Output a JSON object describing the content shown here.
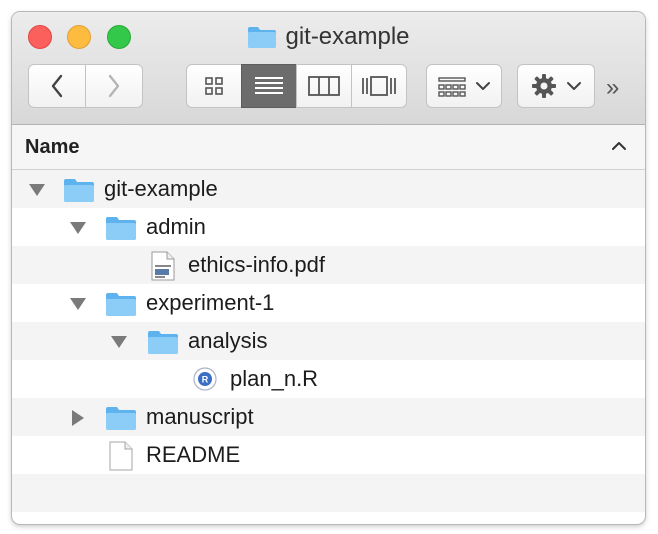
{
  "window": {
    "title": "git-example"
  },
  "toolbar": {
    "back_icon": "chevron-left-icon",
    "forward_icon": "chevron-right-icon",
    "views": [
      "icon-view",
      "list-view",
      "column-view",
      "cover-flow-view"
    ],
    "selected_view": "list-view",
    "arrange_icon": "arrange-grid-icon",
    "action_icon": "gear-icon",
    "overflow": "»"
  },
  "list_header": {
    "name_column": "Name",
    "sort_direction": "ascending"
  },
  "rows": [
    {
      "label": "git-example",
      "type": "folder",
      "expanded": true
    },
    {
      "label": "admin",
      "type": "folder",
      "expanded": true
    },
    {
      "label": "ethics-info.pdf",
      "type": "pdf-file"
    },
    {
      "label": "experiment-1",
      "type": "folder",
      "expanded": true
    },
    {
      "label": "analysis",
      "type": "folder",
      "expanded": true
    },
    {
      "label": "plan_n.R",
      "type": "r-script-file",
      "badge": "R"
    },
    {
      "label": "manuscript",
      "type": "folder",
      "expanded": false
    },
    {
      "label": "README",
      "type": "text-file"
    },
    {
      "label": "",
      "type": "empty"
    }
  ],
  "colors": {
    "folder": "#7ec4f5",
    "folder_tab": "#5eb2ee",
    "selected_view_bg": "#6c6c6c",
    "close": "#fc605c",
    "minimize": "#fdbc40",
    "zoom": "#34c84a"
  }
}
